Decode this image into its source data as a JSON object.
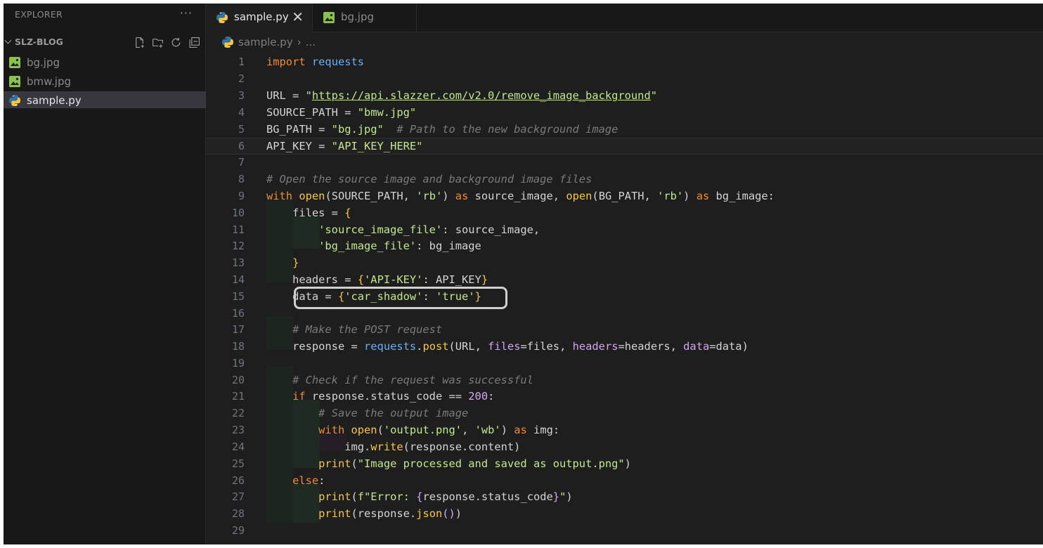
{
  "sidebar": {
    "title": "EXPLORER",
    "more": "···",
    "folder": "SLZ-BLOG",
    "files": [
      {
        "label": "bg.jpg",
        "type": "image"
      },
      {
        "label": "bmw.jpg",
        "type": "image"
      },
      {
        "label": "sample.py",
        "type": "python",
        "selected": true
      }
    ]
  },
  "tabs": [
    {
      "label": "sample.py",
      "type": "python",
      "active": true,
      "close": "✕"
    },
    {
      "label": "bg.jpg",
      "type": "image",
      "active": false
    }
  ],
  "breadcrumb": {
    "file": "sample.py",
    "separator": "›",
    "rest": "..."
  },
  "colors": {
    "python_blue": "#3572a5",
    "python_yellow": "#f6c744",
    "image_icon": "#8bc34a"
  },
  "editor": {
    "line_numbers": [
      "1",
      "2",
      "3",
      "4",
      "5",
      "6",
      "7",
      "8",
      "9",
      "10",
      "11",
      "12",
      "13",
      "14",
      "15",
      "16",
      "17",
      "18",
      "19",
      "20",
      "21",
      "22",
      "23",
      "24",
      "25",
      "26",
      "27",
      "28",
      "29"
    ],
    "t": {
      "import": "import",
      "requests": "requests",
      "url_var": "URL = \"",
      "url_val": "https://api.slazzer.com/v2.0/remove_image_background",
      "quote": "\"",
      "source_path": "SOURCE_PATH = ",
      "source_val": "\"bmw.jpg\"",
      "bg_path": "BG_PATH = ",
      "bg_val": "\"bg.jpg\"",
      "bg_comment": "  # Path to the new background image",
      "api_key": "API_KEY = ",
      "api_val": "\"API_KEY_HERE\"",
      "comment8": "# Open the source image and background image files",
      "with": "with",
      "open": "open",
      "l9a": "(SOURCE_PATH, ",
      "rb": "'rb'",
      "l9b": ") ",
      "as": "as",
      "l9c": " source_image, ",
      "l9d": "(BG_PATH, ",
      "l9e": " bg_image:",
      "files_eq": "files = ",
      "lbrace": "{",
      "rbrace": "}",
      "src_key": "'source_image_file'",
      "src_rest": ": source_image,",
      "bg_key": "'bg_image_file'",
      "bg_rest": ": bg_image",
      "headers_eq": "headers = ",
      "apikey_key": "'API-KEY'",
      "apikey_rest": ": API_KEY",
      "data_eq": "data = ",
      "car_key": "'car_shadow'",
      "colon": ": ",
      "true_val": "'true'",
      "comment17": "# Make the POST request",
      "response_eq": "response = ",
      "dot": ".",
      "post": "post",
      "l18a": "(URL, ",
      "files_kw": "files",
      "l18b": "=files, ",
      "headers_kw": "headers",
      "l18c": "=headers, ",
      "data_kw": "data",
      "l18d": "=data)",
      "comment20": "# Check if the request was successful",
      "if": "if",
      "l21a": " response.status_code == ",
      "num200": "200",
      "colon_end": ":",
      "comment22": "# Save the output image",
      "lparen": "(",
      "output_png": "'output.png'",
      "comma": ", ",
      "wb": "'wb'",
      "rparen_sp": ") ",
      "img_colon": " img:",
      "img": "img",
      "write": "write",
      "l24b": "(response.content)",
      "print": "print",
      "msg25": "\"Image processed and saved as output.png\"",
      "rparen": ")",
      "else": "else",
      "f_prefix": "f\"Error: ",
      "status_inner": "response.status_code",
      "end_quote": "\"",
      "response_json": "response.",
      "json": "json",
      "parens": "()",
      "rparen2": ")"
    }
  }
}
